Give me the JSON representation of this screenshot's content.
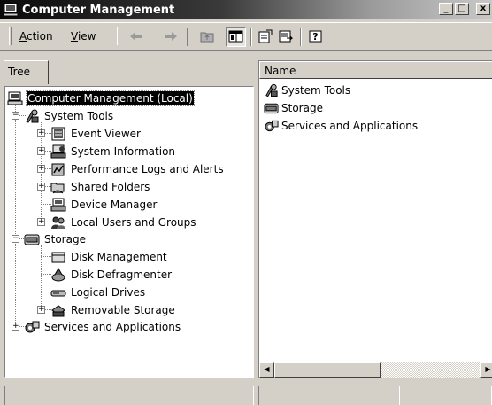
{
  "window": {
    "title": "Computer Management",
    "controls": {
      "minimize": "_",
      "maximize": "□",
      "close": "x"
    }
  },
  "menu": {
    "action_accel": "A",
    "action_rest": "ction",
    "view_accel": "V",
    "view_rest": "iew"
  },
  "toolbar_icons": [
    "back-arrow-icon",
    "forward-arrow-icon",
    "up-folder-icon",
    "show-hide-tree-icon",
    "properties-icon",
    "export-list-icon",
    "help-icon"
  ],
  "left_pane": {
    "tab_label": "Tree",
    "tree": [
      {
        "label": "Computer Management (Local)",
        "icon": "computer-icon",
        "selected": true
      },
      {
        "label": "System Tools",
        "icon": "system-tools-icon",
        "expanded": true
      },
      {
        "label": "Event Viewer",
        "icon": "event-viewer-icon",
        "expandable": true
      },
      {
        "label": "System Information",
        "icon": "system-information-icon",
        "expandable": true
      },
      {
        "label": "Performance Logs and Alerts",
        "icon": "performance-logs-icon",
        "expandable": true
      },
      {
        "label": "Shared Folders",
        "icon": "shared-folders-icon",
        "expandable": true
      },
      {
        "label": "Device Manager",
        "icon": "device-manager-icon",
        "expandable": false
      },
      {
        "label": "Local Users and Groups",
        "icon": "users-groups-icon",
        "expandable": true
      },
      {
        "label": "Storage",
        "icon": "storage-icon",
        "expanded": true
      },
      {
        "label": "Disk Management",
        "icon": "disk-management-icon",
        "expandable": false
      },
      {
        "label": "Disk Defragmenter",
        "icon": "disk-defragmenter-icon",
        "expandable": false
      },
      {
        "label": "Logical Drives",
        "icon": "logical-drives-icon",
        "expandable": false
      },
      {
        "label": "Removable Storage",
        "icon": "removable-storage-icon",
        "expandable": true
      },
      {
        "label": "Services and Applications",
        "icon": "services-applications-icon",
        "expandable": true
      }
    ]
  },
  "right_pane": {
    "column_header": "Name",
    "items": [
      {
        "label": "System Tools",
        "icon": "system-tools-icon"
      },
      {
        "label": "Storage",
        "icon": "storage-icon"
      },
      {
        "label": "Services and Applications",
        "icon": "services-applications-icon"
      }
    ]
  },
  "status_bar": {
    "panels": [
      "",
      "",
      ""
    ]
  },
  "colors": {
    "face": "#d4d0c8",
    "title_dark": "#0a0a0a",
    "title_light": "#c8c8c8",
    "selection": "#000000"
  }
}
